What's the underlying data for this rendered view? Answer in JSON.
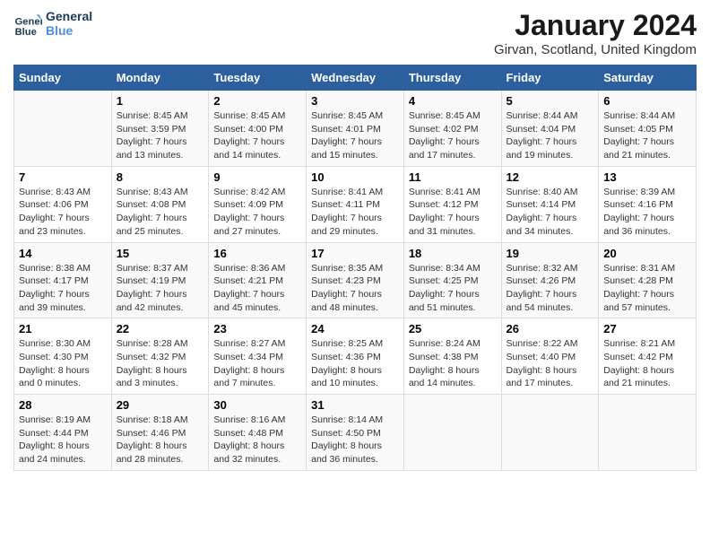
{
  "header": {
    "logo_line1": "General",
    "logo_line2": "Blue",
    "month_title": "January 2024",
    "location": "Girvan, Scotland, United Kingdom"
  },
  "weekdays": [
    "Sunday",
    "Monday",
    "Tuesday",
    "Wednesday",
    "Thursday",
    "Friday",
    "Saturday"
  ],
  "weeks": [
    [
      {
        "day": "",
        "sunrise": "",
        "sunset": "",
        "daylight": ""
      },
      {
        "day": "1",
        "sunrise": "Sunrise: 8:45 AM",
        "sunset": "Sunset: 3:59 PM",
        "daylight": "Daylight: 7 hours and 13 minutes."
      },
      {
        "day": "2",
        "sunrise": "Sunrise: 8:45 AM",
        "sunset": "Sunset: 4:00 PM",
        "daylight": "Daylight: 7 hours and 14 minutes."
      },
      {
        "day": "3",
        "sunrise": "Sunrise: 8:45 AM",
        "sunset": "Sunset: 4:01 PM",
        "daylight": "Daylight: 7 hours and 15 minutes."
      },
      {
        "day": "4",
        "sunrise": "Sunrise: 8:45 AM",
        "sunset": "Sunset: 4:02 PM",
        "daylight": "Daylight: 7 hours and 17 minutes."
      },
      {
        "day": "5",
        "sunrise": "Sunrise: 8:44 AM",
        "sunset": "Sunset: 4:04 PM",
        "daylight": "Daylight: 7 hours and 19 minutes."
      },
      {
        "day": "6",
        "sunrise": "Sunrise: 8:44 AM",
        "sunset": "Sunset: 4:05 PM",
        "daylight": "Daylight: 7 hours and 21 minutes."
      }
    ],
    [
      {
        "day": "7",
        "sunrise": "Sunrise: 8:43 AM",
        "sunset": "Sunset: 4:06 PM",
        "daylight": "Daylight: 7 hours and 23 minutes."
      },
      {
        "day": "8",
        "sunrise": "Sunrise: 8:43 AM",
        "sunset": "Sunset: 4:08 PM",
        "daylight": "Daylight: 7 hours and 25 minutes."
      },
      {
        "day": "9",
        "sunrise": "Sunrise: 8:42 AM",
        "sunset": "Sunset: 4:09 PM",
        "daylight": "Daylight: 7 hours and 27 minutes."
      },
      {
        "day": "10",
        "sunrise": "Sunrise: 8:41 AM",
        "sunset": "Sunset: 4:11 PM",
        "daylight": "Daylight: 7 hours and 29 minutes."
      },
      {
        "day": "11",
        "sunrise": "Sunrise: 8:41 AM",
        "sunset": "Sunset: 4:12 PM",
        "daylight": "Daylight: 7 hours and 31 minutes."
      },
      {
        "day": "12",
        "sunrise": "Sunrise: 8:40 AM",
        "sunset": "Sunset: 4:14 PM",
        "daylight": "Daylight: 7 hours and 34 minutes."
      },
      {
        "day": "13",
        "sunrise": "Sunrise: 8:39 AM",
        "sunset": "Sunset: 4:16 PM",
        "daylight": "Daylight: 7 hours and 36 minutes."
      }
    ],
    [
      {
        "day": "14",
        "sunrise": "Sunrise: 8:38 AM",
        "sunset": "Sunset: 4:17 PM",
        "daylight": "Daylight: 7 hours and 39 minutes."
      },
      {
        "day": "15",
        "sunrise": "Sunrise: 8:37 AM",
        "sunset": "Sunset: 4:19 PM",
        "daylight": "Daylight: 7 hours and 42 minutes."
      },
      {
        "day": "16",
        "sunrise": "Sunrise: 8:36 AM",
        "sunset": "Sunset: 4:21 PM",
        "daylight": "Daylight: 7 hours and 45 minutes."
      },
      {
        "day": "17",
        "sunrise": "Sunrise: 8:35 AM",
        "sunset": "Sunset: 4:23 PM",
        "daylight": "Daylight: 7 hours and 48 minutes."
      },
      {
        "day": "18",
        "sunrise": "Sunrise: 8:34 AM",
        "sunset": "Sunset: 4:25 PM",
        "daylight": "Daylight: 7 hours and 51 minutes."
      },
      {
        "day": "19",
        "sunrise": "Sunrise: 8:32 AM",
        "sunset": "Sunset: 4:26 PM",
        "daylight": "Daylight: 7 hours and 54 minutes."
      },
      {
        "day": "20",
        "sunrise": "Sunrise: 8:31 AM",
        "sunset": "Sunset: 4:28 PM",
        "daylight": "Daylight: 7 hours and 57 minutes."
      }
    ],
    [
      {
        "day": "21",
        "sunrise": "Sunrise: 8:30 AM",
        "sunset": "Sunset: 4:30 PM",
        "daylight": "Daylight: 8 hours and 0 minutes."
      },
      {
        "day": "22",
        "sunrise": "Sunrise: 8:28 AM",
        "sunset": "Sunset: 4:32 PM",
        "daylight": "Daylight: 8 hours and 3 minutes."
      },
      {
        "day": "23",
        "sunrise": "Sunrise: 8:27 AM",
        "sunset": "Sunset: 4:34 PM",
        "daylight": "Daylight: 8 hours and 7 minutes."
      },
      {
        "day": "24",
        "sunrise": "Sunrise: 8:25 AM",
        "sunset": "Sunset: 4:36 PM",
        "daylight": "Daylight: 8 hours and 10 minutes."
      },
      {
        "day": "25",
        "sunrise": "Sunrise: 8:24 AM",
        "sunset": "Sunset: 4:38 PM",
        "daylight": "Daylight: 8 hours and 14 minutes."
      },
      {
        "day": "26",
        "sunrise": "Sunrise: 8:22 AM",
        "sunset": "Sunset: 4:40 PM",
        "daylight": "Daylight: 8 hours and 17 minutes."
      },
      {
        "day": "27",
        "sunrise": "Sunrise: 8:21 AM",
        "sunset": "Sunset: 4:42 PM",
        "daylight": "Daylight: 8 hours and 21 minutes."
      }
    ],
    [
      {
        "day": "28",
        "sunrise": "Sunrise: 8:19 AM",
        "sunset": "Sunset: 4:44 PM",
        "daylight": "Daylight: 8 hours and 24 minutes."
      },
      {
        "day": "29",
        "sunrise": "Sunrise: 8:18 AM",
        "sunset": "Sunset: 4:46 PM",
        "daylight": "Daylight: 8 hours and 28 minutes."
      },
      {
        "day": "30",
        "sunrise": "Sunrise: 8:16 AM",
        "sunset": "Sunset: 4:48 PM",
        "daylight": "Daylight: 8 hours and 32 minutes."
      },
      {
        "day": "31",
        "sunrise": "Sunrise: 8:14 AM",
        "sunset": "Sunset: 4:50 PM",
        "daylight": "Daylight: 8 hours and 36 minutes."
      },
      {
        "day": "",
        "sunrise": "",
        "sunset": "",
        "daylight": ""
      },
      {
        "day": "",
        "sunrise": "",
        "sunset": "",
        "daylight": ""
      },
      {
        "day": "",
        "sunrise": "",
        "sunset": "",
        "daylight": ""
      }
    ]
  ]
}
